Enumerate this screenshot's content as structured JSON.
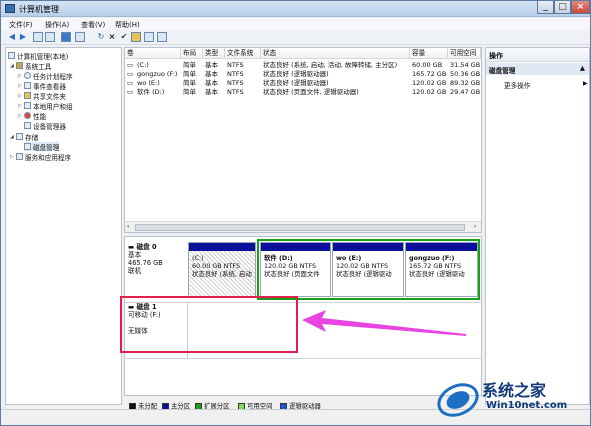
{
  "window": {
    "title": "计算机管理"
  },
  "menu": [
    "文件(F)",
    "操作(A)",
    "查看(V)",
    "帮助(H)"
  ],
  "tree": [
    {
      "label": "计算机管理(本地)",
      "icon": "computer-icon"
    },
    {
      "label": "系统工具",
      "icon": "tools-icon"
    },
    {
      "label": "任务计划程序",
      "icon": "clock-icon"
    },
    {
      "label": "事件查看器",
      "icon": "event-icon"
    },
    {
      "label": "共享文件夹",
      "icon": "folder-icon"
    },
    {
      "label": "本地用户和组",
      "icon": "users-icon"
    },
    {
      "label": "性能",
      "icon": "perf-icon"
    },
    {
      "label": "设备管理器",
      "icon": "device-icon"
    },
    {
      "label": "存储",
      "icon": "storage-icon"
    },
    {
      "label": "磁盘管理",
      "icon": "disk-icon"
    },
    {
      "label": "服务和应用程序",
      "icon": "services-icon"
    }
  ],
  "volumes": {
    "headers": [
      "卷",
      "布局",
      "类型",
      "文件系统",
      "状态",
      "容量",
      "可用空间"
    ],
    "rows": [
      [
        "(C:)",
        "简单",
        "基本",
        "NTFS",
        "状态良好 (系统, 启动, 活动, 故障转储, 主分区)",
        "60.00 GB",
        "31.54 GB"
      ],
      [
        "gongzuo (F:)",
        "简单",
        "基本",
        "NTFS",
        "状态良好 (逻辑驱动器)",
        "165.72 GB",
        "50.36 GB"
      ],
      [
        "wo (E:)",
        "简单",
        "基本",
        "NTFS",
        "状态良好 (逻辑驱动器)",
        "120.02 GB",
        "89.32 GB"
      ],
      [
        "软件 (D:)",
        "简单",
        "基本",
        "NTFS",
        "状态良好 (页面文件, 逻辑驱动器)",
        "120.02 GB",
        "29.47 GB"
      ]
    ]
  },
  "disk0": {
    "name": "磁盘 0",
    "type": "基本",
    "size": "465.76 GB",
    "status": "联机",
    "parts": [
      {
        "name": "(C:)",
        "size": "60.00 GB NTFS",
        "status": "状态良好 (系统, 启动"
      },
      {
        "name": "软件 (D:)",
        "size": "120.02 GB NTFS",
        "status": "状态良好 (页面文件"
      },
      {
        "name": "wo (E:)",
        "size": "120.02 GB NTFS",
        "status": "状态良好 (逻辑驱动"
      },
      {
        "name": "gongzuo (F:)",
        "size": "165.72 GB NTFS",
        "status": "状态良好 (逻辑驱动"
      }
    ]
  },
  "disk1": {
    "name": "磁盘 1",
    "type": "可移动 (F:)",
    "status": "无媒体"
  },
  "legend": [
    "未分配",
    "主分区",
    "扩展分区",
    "可用空间",
    "逻辑驱动器"
  ],
  "actions": {
    "header": "操作",
    "section": "磁盘管理",
    "item": "更多操作"
  },
  "watermark": {
    "title": "系统之家",
    "sub": "Win10net.com"
  },
  "colors": {
    "primary": "#0a0f9c",
    "extended": "#18a018",
    "annotation": "#e0204c"
  }
}
